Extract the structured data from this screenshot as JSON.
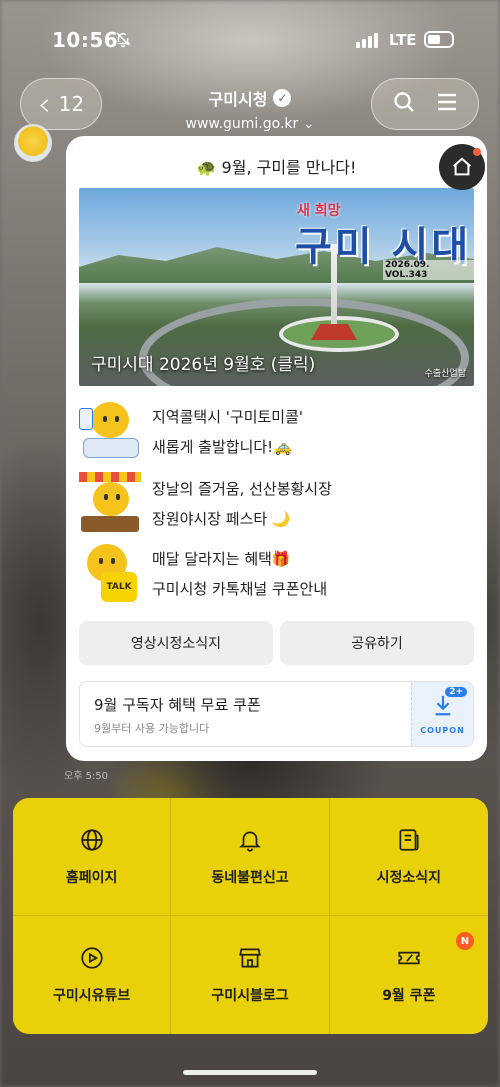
{
  "status_bar": {
    "time": "10:56",
    "network": "LTE",
    "icons": [
      "bell-off-icon",
      "signal-icon",
      "battery-icon"
    ]
  },
  "header": {
    "back_count": "12",
    "channel_name": "구미시청",
    "url": "www.gumi.go.kr",
    "icons": [
      "back-chevron-icon",
      "verified-icon",
      "chevron-down-icon",
      "search-icon",
      "menu-icon"
    ]
  },
  "card": {
    "headline_emoji": "🐢",
    "headline": "9월, 구미를 만나다!",
    "banner": {
      "subtitle": "새 희망",
      "title": "구미 시대",
      "volume": "2026.09. VOL.343",
      "caption": "구미시대 2026년 9월호 (클릭)",
      "credit": "수출산업탑"
    },
    "news": [
      {
        "line1": "지역콜택시 '구미토미콜'",
        "line2": "새롭게 출발합니다!🚕"
      },
      {
        "line1": "장날의 즐거움, 선산봉황시장",
        "line2": "장원야시장 페스타 🌙"
      },
      {
        "line1": "매달 달라지는 혜택🎁",
        "line2": "구미시청 카톡채널 쿠폰안내",
        "thumb_label": "TALK"
      }
    ],
    "buttons": {
      "video": "영상시정소식지",
      "share": "공유하기"
    },
    "coupon": {
      "title": "9월 구독자 혜택 무료 쿠폰",
      "subtitle": "9월부터 사용 가능합니다",
      "label": "COUPON",
      "badge": "2+"
    }
  },
  "timestamp": "오후 5:50",
  "menu": [
    {
      "label": "홈페이지",
      "icon": "globe-icon"
    },
    {
      "label": "동네불편신고",
      "icon": "bell-icon"
    },
    {
      "label": "시정소식지",
      "icon": "newsletter-icon"
    },
    {
      "label": "구미시유튜브",
      "icon": "play-icon"
    },
    {
      "label": "구미시블로그",
      "icon": "store-icon"
    },
    {
      "label": "9월 쿠폰",
      "icon": "ticket-icon",
      "badge": "N"
    }
  ],
  "colors": {
    "menu_bg": "#e9d10a",
    "accent_blue": "#2b7de9",
    "badge_orange": "#ff5a1f"
  }
}
